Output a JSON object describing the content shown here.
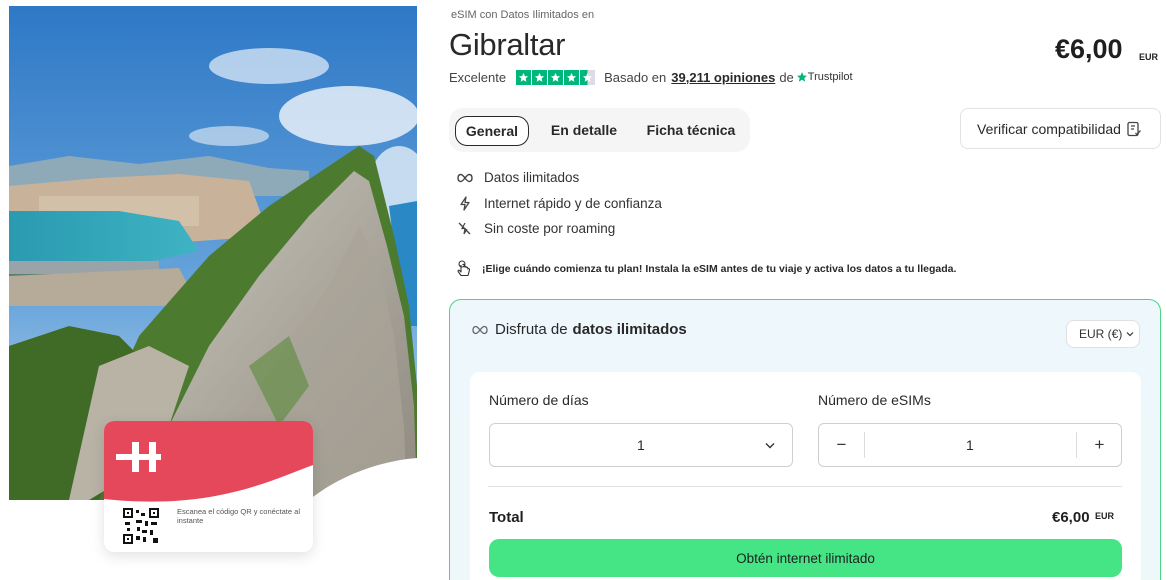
{
  "hero": {
    "card_text": "Escanea el código QR y conéctate al instante"
  },
  "header": {
    "subtitle": "eSIM con Datos Ilimitados en",
    "title": "Gibraltar",
    "price": "€6,00",
    "price_currency": "EUR"
  },
  "rating": {
    "label": "Excelente",
    "stars": 4.5,
    "based_on": "Basado en",
    "reviews_link": "39,211 opiniones",
    "de": "de",
    "brand": "Trustpilot"
  },
  "tabs": [
    {
      "label": "General",
      "active": true
    },
    {
      "label": "En detalle",
      "active": false
    },
    {
      "label": "Ficha técnica",
      "active": false
    }
  ],
  "verify_button": "Verificar compatibilidad",
  "features": [
    {
      "icon": "infinity-icon",
      "label": "Datos ilimitados"
    },
    {
      "icon": "lightning-icon",
      "label": "Internet rápido y de confianza"
    },
    {
      "icon": "no-roaming-icon",
      "label": "Sin coste por roaming"
    }
  ],
  "note": "¡Elige cuándo comienza tu plan! Instala la eSIM antes de tu viaje y activa los datos a tu llegada.",
  "plan": {
    "title_prefix": "Disfruta de",
    "title_bold": "datos ilimitados",
    "currency_select": "EUR (€)",
    "days_label": "Número de días",
    "days_value": "1",
    "esims_label": "Número de eSIMs",
    "esims_value": "1",
    "minus": "−",
    "plus": "+",
    "total_label": "Total",
    "total_value": "€6,00",
    "total_currency": "EUR",
    "cta": "Obtén internet ilimitado"
  },
  "colors": {
    "accent_green": "#45e585",
    "trustpilot_green": "#00b67a",
    "brand_red": "#e5475b",
    "box_border": "#4bd387"
  }
}
